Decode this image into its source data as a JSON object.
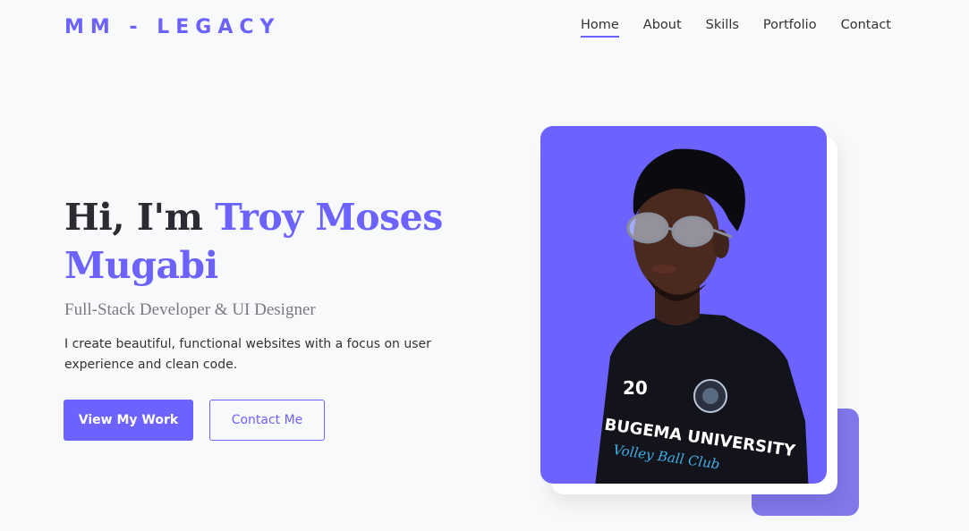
{
  "header": {
    "logo": "MM - LEGACY",
    "nav": [
      {
        "label": "Home",
        "active": true
      },
      {
        "label": "About",
        "active": false
      },
      {
        "label": "Skills",
        "active": false
      },
      {
        "label": "Portfolio",
        "active": false
      },
      {
        "label": "Contact",
        "active": false
      }
    ]
  },
  "hero": {
    "greeting": "Hi, I'm",
    "name": "Troy Moses Mugabi",
    "subtitle": "Full-Stack Developer & UI Designer",
    "description": "I create beautiful, functional websites with a focus on user experience and clean code.",
    "primary_button": "View My Work",
    "secondary_button": "Contact Me"
  },
  "portrait": {
    "shirt_number": "20",
    "shirt_text": "BUGEMA UNIVERSITY",
    "shirt_script": "Volley Ball Club"
  },
  "colors": {
    "accent": "#6c63ff",
    "accent_block": "#8178ec",
    "background": "#f8f9fb"
  }
}
